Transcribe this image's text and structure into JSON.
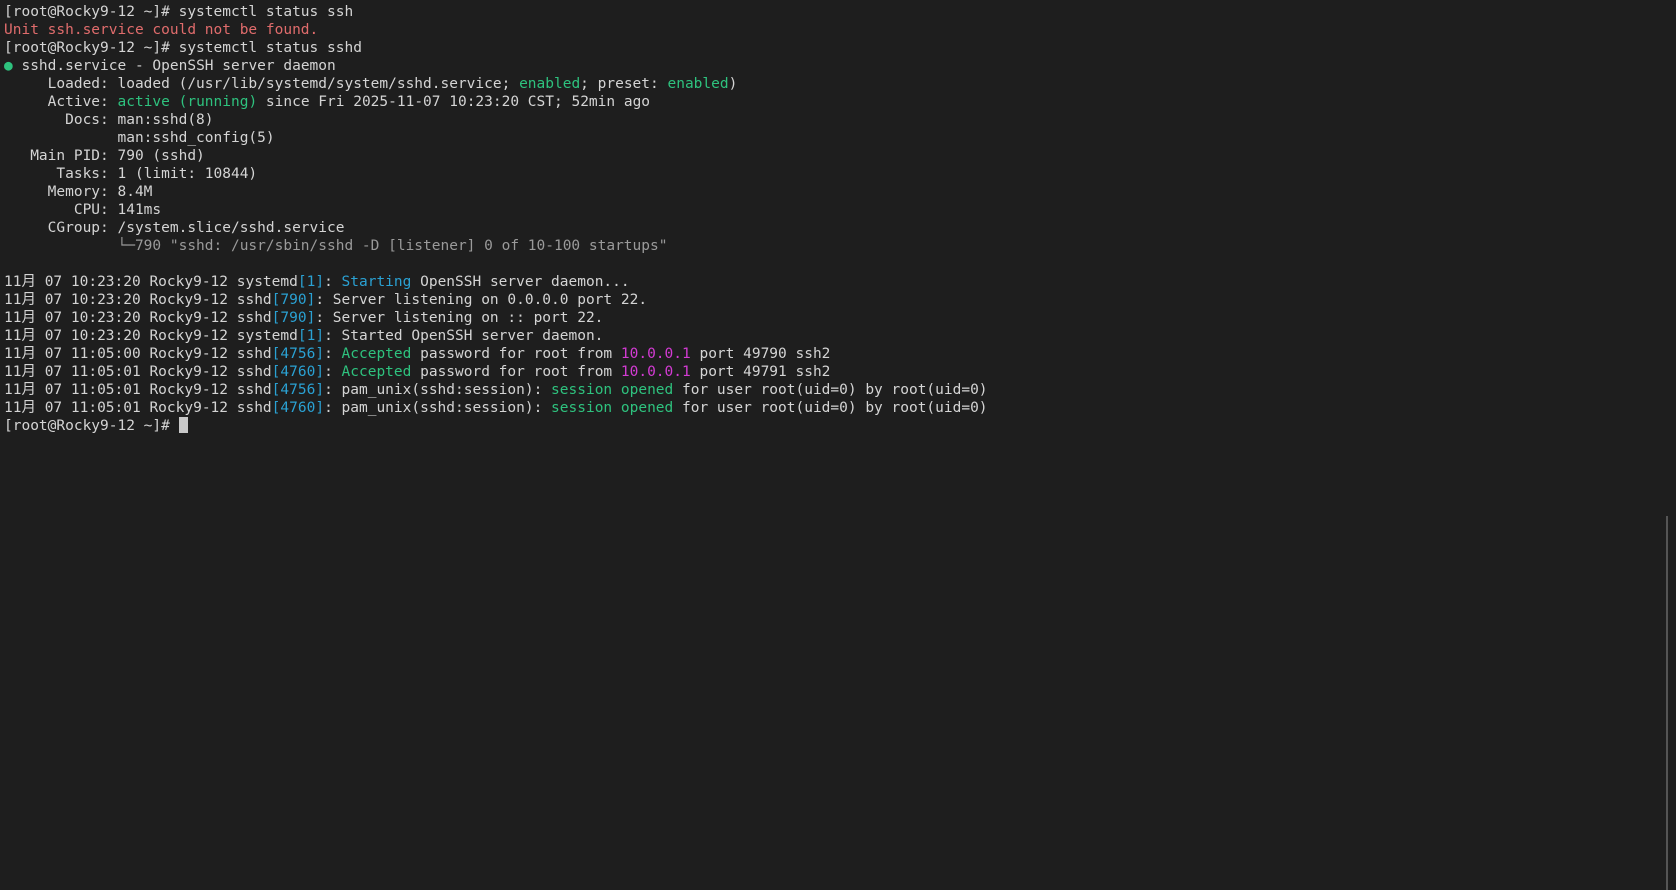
{
  "colors": {
    "background": "#1e1e1e",
    "text": "#d4d4d4",
    "error": "#e06c6c",
    "status_green": "#2ec27e",
    "pid_cyan": "#2aa1d3",
    "ip_magenta": "#d33bd3",
    "tree_gray": "#9a9a9a"
  },
  "lines": [
    [
      {
        "t": "[root@Rocky9-12 ~]# systemctl status ssh"
      }
    ],
    [
      {
        "t": "Unit ssh.service could not be found.",
        "c": "red"
      }
    ],
    [
      {
        "t": "[root@Rocky9-12 ~]# systemctl status sshd"
      }
    ],
    [
      {
        "t": "● ",
        "c": "green"
      },
      {
        "t": "sshd.service - OpenSSH server daemon"
      }
    ],
    [
      {
        "t": "     Loaded: loaded (/usr/lib/systemd/system/sshd.service; "
      },
      {
        "t": "enabled",
        "c": "green"
      },
      {
        "t": "; preset: "
      },
      {
        "t": "enabled",
        "c": "green"
      },
      {
        "t": ")"
      }
    ],
    [
      {
        "t": "     Active: "
      },
      {
        "t": "active (running)",
        "c": "green"
      },
      {
        "t": " since Fri 2025-11-07 10:23:20 CST; 52min ago"
      }
    ],
    [
      {
        "t": "       Docs: man:sshd(8)"
      }
    ],
    [
      {
        "t": "             man:sshd_config(5)"
      }
    ],
    [
      {
        "t": "   Main PID: 790 (sshd)"
      }
    ],
    [
      {
        "t": "      Tasks: 1 (limit: 10844)"
      }
    ],
    [
      {
        "t": "     Memory: 8.4M"
      }
    ],
    [
      {
        "t": "        CPU: 141ms"
      }
    ],
    [
      {
        "t": "     CGroup: /system.slice/sshd.service"
      }
    ],
    [
      {
        "t": "             └─790 \"sshd: /usr/sbin/sshd -D [listener] 0 of 10-100 startups\"",
        "c": "gray"
      }
    ],
    [
      {
        "t": ""
      }
    ],
    [
      {
        "t": "11月 07 10:23:20 Rocky9-12 systemd"
      },
      {
        "t": "[1]",
        "c": "cyan"
      },
      {
        "t": ": "
      },
      {
        "t": "Starting",
        "c": "cyan"
      },
      {
        "t": " OpenSSH server daemon..."
      }
    ],
    [
      {
        "t": "11月 07 10:23:20 Rocky9-12 sshd"
      },
      {
        "t": "[790]",
        "c": "cyan"
      },
      {
        "t": ": Server listening on 0.0.0.0 port 22."
      }
    ],
    [
      {
        "t": "11月 07 10:23:20 Rocky9-12 sshd"
      },
      {
        "t": "[790]",
        "c": "cyan"
      },
      {
        "t": ": Server listening on :: port 22."
      }
    ],
    [
      {
        "t": "11月 07 10:23:20 Rocky9-12 systemd"
      },
      {
        "t": "[1]",
        "c": "cyan"
      },
      {
        "t": ": Started OpenSSH server daemon."
      }
    ],
    [
      {
        "t": "11月 07 11:05:00 Rocky9-12 sshd"
      },
      {
        "t": "[4756]",
        "c": "cyan"
      },
      {
        "t": ": "
      },
      {
        "t": "Accepted",
        "c": "green"
      },
      {
        "t": " password for root from "
      },
      {
        "t": "10.0.0.1",
        "c": "magenta"
      },
      {
        "t": " port 49790 ssh2"
      }
    ],
    [
      {
        "t": "11月 07 11:05:01 Rocky9-12 sshd"
      },
      {
        "t": "[4760]",
        "c": "cyan"
      },
      {
        "t": ": "
      },
      {
        "t": "Accepted",
        "c": "green"
      },
      {
        "t": " password for root from "
      },
      {
        "t": "10.0.0.1",
        "c": "magenta"
      },
      {
        "t": " port 49791 ssh2"
      }
    ],
    [
      {
        "t": "11月 07 11:05:01 Rocky9-12 sshd"
      },
      {
        "t": "[4756]",
        "c": "cyan"
      },
      {
        "t": ": pam_unix(sshd:session): "
      },
      {
        "t": "session opened",
        "c": "green"
      },
      {
        "t": " for user root(uid=0) by root(uid=0)"
      }
    ],
    [
      {
        "t": "11月 07 11:05:01 Rocky9-12 sshd"
      },
      {
        "t": "[4760]",
        "c": "cyan"
      },
      {
        "t": ": pam_unix(sshd:session): "
      },
      {
        "t": "session opened",
        "c": "green"
      },
      {
        "t": " for user root(uid=0) by root(uid=0)"
      }
    ]
  ],
  "prompt": "[root@Rocky9-12 ~]# "
}
